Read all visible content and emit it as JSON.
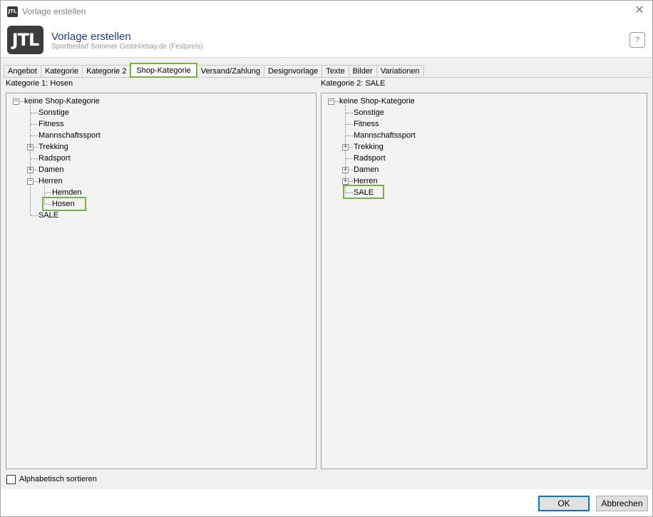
{
  "window": {
    "title": "Vorlage erstellen",
    "logo_text": "JTL"
  },
  "header": {
    "title": "Vorlage erstellen",
    "subtitle": "Sportbedarf Sommer GmbH/ebay.de (Festpreis)",
    "logo_text": "JTL",
    "help_glyph": "?"
  },
  "tabs": [
    {
      "label": "Angebot",
      "active": false
    },
    {
      "label": "Kategorie",
      "active": false
    },
    {
      "label": "Kategorie 2",
      "active": false
    },
    {
      "label": "Shop-Kategorie",
      "active": true
    },
    {
      "label": "Versand/Zahlung",
      "active": false
    },
    {
      "label": "Designvorlage",
      "active": false
    },
    {
      "label": "Texte",
      "active": false
    },
    {
      "label": "Bilder",
      "active": false
    },
    {
      "label": "Variationen",
      "active": false
    }
  ],
  "left": {
    "label": "Kategorie 1: Hosen",
    "root": "keine Shop-Kategorie",
    "items": [
      "Sonstige",
      "Fitness",
      "Mannschaftssport",
      "Trekking",
      "Radsport",
      "Damen",
      "Herren",
      "Hemden",
      "Hosen",
      "SALE"
    ]
  },
  "right": {
    "label": "Kategorie 2: SALE",
    "root": "keine Shop-Kategorie",
    "items": [
      "Sonstige",
      "Fitness",
      "Mannschaftssport",
      "Trekking",
      "Radsport",
      "Damen",
      "Herren",
      "SALE"
    ]
  },
  "options": {
    "sort_label": "Alphabetisch sortieren"
  },
  "buttons": {
    "ok": "OK",
    "cancel": "Abbrechen"
  },
  "colors": {
    "highlight": "#7bb13f",
    "title_blue": "#1f3f84",
    "primary_border": "#0078d7"
  }
}
